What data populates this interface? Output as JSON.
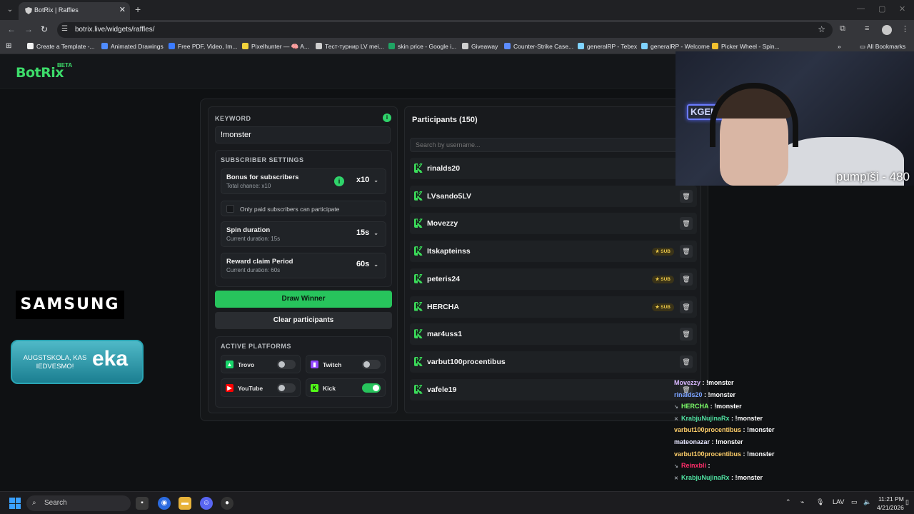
{
  "browser": {
    "tab_title": "BotRix | Raffles",
    "url": "botrix.live/widgets/raffles/",
    "bookmarks": [
      {
        "label": "Create a Template -...",
        "color": "#f1f1f1"
      },
      {
        "label": "Animated Drawings",
        "color": "#4f8cff"
      },
      {
        "label": "Free PDF, Video, Im...",
        "color": "#3b7bff"
      },
      {
        "label": "Pixelhunter — 🧠 A...",
        "color": "#f2d33b"
      },
      {
        "label": "Тест-турнир LV mei...",
        "color": "#cfcfcf"
      },
      {
        "label": "skin price - Google i...",
        "color": "#1fa463"
      },
      {
        "label": "Giveaway",
        "color": "#cfcfcf"
      },
      {
        "label": "Counter-Strike Case...",
        "color": "#5c8cff"
      },
      {
        "label": "generalRP - Tebex",
        "color": "#7fd3ff"
      },
      {
        "label": "generalRP - Welcome",
        "color": "#7fd3ff"
      },
      {
        "label": "Picker Wheel - Spin...",
        "color": "#f2c12e"
      }
    ],
    "all_bookmarks": "All Bookmarks"
  },
  "app": {
    "logo": "BotRix",
    "logo_badge": "BETA"
  },
  "sponsors": {
    "samsung": "SAMSUNG",
    "eka_small": "AUGSTSKOLA, KAS IEDVESMO!",
    "eka_big": "eka"
  },
  "raffle": {
    "keyword_label": "KEYWORD",
    "keyword_value": "!monster",
    "subscriber_settings_label": "SUBSCRIBER SETTINGS",
    "bonus_title": "Bonus for subscribers",
    "bonus_sub": "Total chance: x10",
    "bonus_value": "x10",
    "only_paid_label": "Only paid subscribers can participate",
    "spin_title": "Spin duration",
    "spin_sub": "Current duration: 15s",
    "spin_value": "15s",
    "claim_title": "Reward claim Period",
    "claim_sub": "Current duration: 60s",
    "claim_value": "60s",
    "draw_button": "Draw Winner",
    "clear_button": "Clear participants",
    "platforms_label": "ACTIVE PLATFORMS",
    "platforms": [
      {
        "name": "Trovo",
        "enabled": false,
        "color": "#19d66b"
      },
      {
        "name": "Twitch",
        "enabled": false,
        "color": "#9146ff"
      },
      {
        "name": "YouTube",
        "enabled": false,
        "color": "#ff0000"
      },
      {
        "name": "Kick",
        "enabled": true,
        "color": "#53fc18"
      }
    ],
    "participants_title": "Participants (150)",
    "search_placeholder": "Search by username...",
    "sub_badge": "SUB",
    "participants": [
      {
        "name": "rinalds20",
        "sub": false
      },
      {
        "name": "LVsando5LV",
        "sub": false
      },
      {
        "name": "Movezzy",
        "sub": false
      },
      {
        "name": "Itskapteinss",
        "sub": true
      },
      {
        "name": "peteris24",
        "sub": true
      },
      {
        "name": "HERCHA",
        "sub": true
      },
      {
        "name": "mar4uss1",
        "sub": false
      },
      {
        "name": "varbut100procentibus",
        "sub": false
      },
      {
        "name": "vafele19",
        "sub": false
      }
    ]
  },
  "stream": {
    "cam_caption": "pumpīši - 480",
    "neon_sign": "KGEN"
  },
  "chat": [
    {
      "user": "Movezzy",
      "msg": "!monster",
      "color": "#d9b8ff",
      "badge": ""
    },
    {
      "user": "rinalds20",
      "msg": "!monster",
      "color": "#7aa2ff",
      "badge": ""
    },
    {
      "user": "HERCHA",
      "msg": "!monster",
      "color": "#7dff6a",
      "badge": "↘"
    },
    {
      "user": "KrabjuNujinaRx",
      "msg": "!monster",
      "color": "#4fe0a0",
      "badge": "✕"
    },
    {
      "user": "varbut100procentibus",
      "msg": "!monster",
      "color": "#ffcf6a",
      "badge": ""
    },
    {
      "user": "mateonazar",
      "msg": "!monster",
      "color": "#e6e6ff",
      "badge": ""
    },
    {
      "user": "varbut100procentibus",
      "msg": "!monster",
      "color": "#ffcf6a",
      "badge": ""
    },
    {
      "user": "Reinxbli",
      "msg": "",
      "color": "#ff2d6a",
      "badge": "↘"
    },
    {
      "user": "KrabjuNujinaRx",
      "msg": "!monster",
      "color": "#4fe0a0",
      "badge": "✕"
    }
  ],
  "taskbar": {
    "search_label": "Search",
    "language": "LAV",
    "time": "11:21 PM",
    "date": "4/21/2026"
  }
}
